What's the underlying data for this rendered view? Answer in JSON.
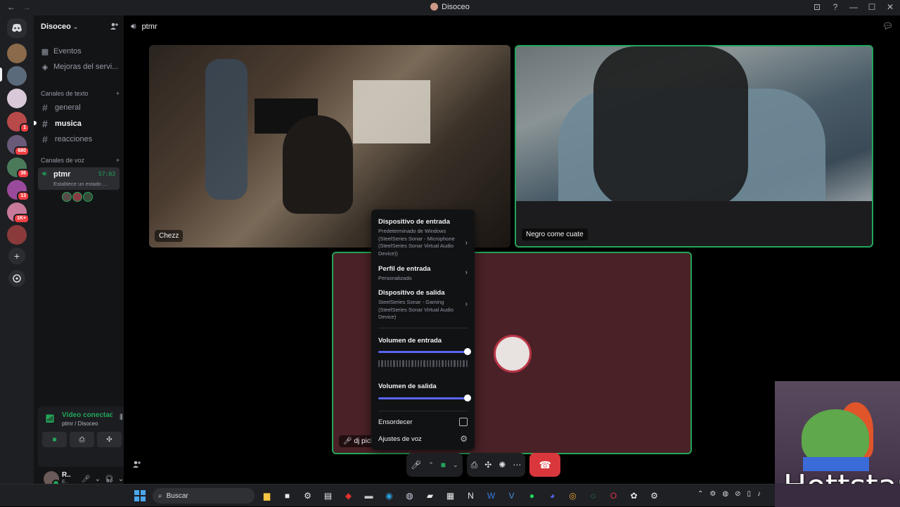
{
  "window": {
    "title": "Disoceo",
    "nav_back": "←",
    "nav_forward": "→",
    "controls": [
      "⊡",
      "?",
      "—",
      "☐",
      "✕"
    ]
  },
  "servers": [
    {
      "name": "server-1",
      "color": "#8a6a4a",
      "badge": ""
    },
    {
      "name": "server-disoceo",
      "color": "#5a6a7a",
      "badge": ""
    },
    {
      "name": "server-3",
      "color": "#d8c8d8",
      "badge": ""
    },
    {
      "name": "server-4",
      "color": "#b84a4a",
      "badge": "1"
    },
    {
      "name": "server-5",
      "color": "#6a5a7a",
      "badge": "680"
    },
    {
      "name": "server-6",
      "color": "#4a7a5a",
      "badge": "36"
    },
    {
      "name": "server-7",
      "color": "#9a4a9a",
      "badge": "13"
    },
    {
      "name": "server-8",
      "color": "#c87a9a",
      "badge": "1K+"
    },
    {
      "name": "server-9",
      "color": "#8a3a3a",
      "badge": ""
    }
  ],
  "sidebar": {
    "guild_name": "Disoceo",
    "chevron": "⌄",
    "events_label": "Eventos",
    "boosts_label": "Mejoras del servi...",
    "text_category": "Canales de texto",
    "voice_category": "Canales de voz",
    "plus": "+",
    "text_channels": [
      {
        "name": "general",
        "active": false
      },
      {
        "name": "musica",
        "active": true
      },
      {
        "name": "reacciones",
        "active": false
      }
    ],
    "voice_channel": {
      "name": "ptmr",
      "time": "57:03",
      "status": "Establece un estado ..."
    }
  },
  "rtc_panel": {
    "status": "Vídeo conectado",
    "location": "ptmr / Disoceo"
  },
  "user": {
    "name": "R..",
    "sub": "E.."
  },
  "stage": {
    "channel_name": "ptmr",
    "tiles": [
      {
        "label": "Chezz"
      },
      {
        "label": "Negro come cuate"
      },
      {
        "label": "dj pich"
      }
    ]
  },
  "popover": {
    "input_device_title": "Dispositivo de entrada",
    "input_device_value": "Predeterminado de Windows (SteelSeries Sonar - Microphone (SteelSeries Sonar Virtual Audio Device))",
    "input_profile_title": "Perfil de entrada",
    "input_profile_value": "Personalizado",
    "output_device_title": "Dispositivo de salida",
    "output_device_value": "SteelSeries Sonar - Gaming (SteelSeries Sonar Virtual Audio Device)",
    "input_volume_label": "Volumen de entrada",
    "input_volume": 1.0,
    "output_volume_label": "Volumen de salida",
    "output_volume": 1.0,
    "deafen_label": "Ensordecer",
    "voice_settings_label": "Ajustes de voz"
  },
  "overlay": {
    "text": "Hottstar"
  },
  "taskbar": {
    "search_placeholder": "Buscar",
    "apps": [
      {
        "name": "file-explorer-icon",
        "glyph": "▆",
        "color": "#f4c542"
      },
      {
        "name": "store-icon",
        "glyph": "■",
        "color": "#e8e8e8"
      },
      {
        "name": "steelseries-icon",
        "glyph": "⚙",
        "color": "#e8e8e8"
      },
      {
        "name": "app-icon",
        "glyph": "▤",
        "color": "#e8e8e8"
      },
      {
        "name": "red-diamond-icon",
        "glyph": "◆",
        "color": "#e03030"
      },
      {
        "name": "notepad-icon",
        "glyph": "▬",
        "color": "#c8c8c8"
      },
      {
        "name": "edge-icon",
        "glyph": "◉",
        "color": "#2aa0e0"
      },
      {
        "name": "steam-icon",
        "glyph": "◍",
        "color": "#c8d0e0"
      },
      {
        "name": "nvidia-icon",
        "glyph": "▰",
        "color": "#e8e8e8"
      },
      {
        "name": "calendar-icon",
        "glyph": "▦",
        "color": "#e8e8e8"
      },
      {
        "name": "notion-icon",
        "glyph": "N",
        "color": "#e8e8e8"
      },
      {
        "name": "word-icon",
        "glyph": "W",
        "color": "#3a7ae0"
      },
      {
        "name": "vpn-icon",
        "glyph": "V",
        "color": "#4a90e0"
      },
      {
        "name": "spotify-icon",
        "glyph": "●",
        "color": "#1ed760"
      },
      {
        "name": "discord-icon",
        "glyph": "◕",
        "color": "#5865f2"
      },
      {
        "name": "chrome-icon",
        "glyph": "◎",
        "color": "#e8a030"
      },
      {
        "name": "whatsapp-icon",
        "glyph": "◌",
        "color": "#25d366"
      },
      {
        "name": "opera-icon",
        "glyph": "O",
        "color": "#e0304a"
      },
      {
        "name": "chatgpt-icon",
        "glyph": "✿",
        "color": "#e8e8e8"
      },
      {
        "name": "steelseries-gg-icon",
        "glyph": "⚙",
        "color": "#e8e8e8"
      }
    ],
    "tray": [
      "⌃",
      "⚙",
      "◍",
      "⊘",
      "▯",
      "♪"
    ]
  }
}
